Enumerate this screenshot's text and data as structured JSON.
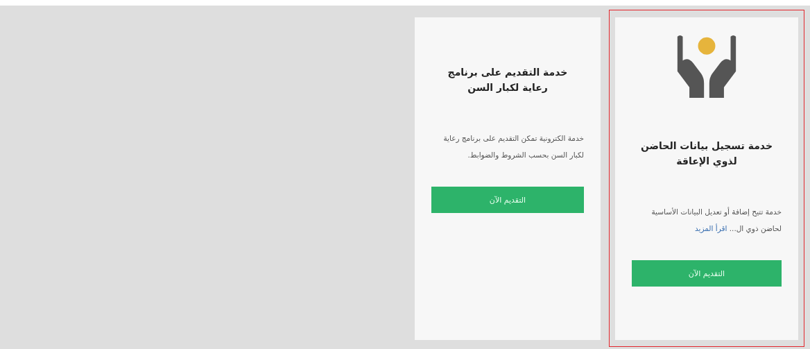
{
  "cards": [
    {
      "title": "خدمة تسجيل بيانات الحاضن لذوي الإعاقة",
      "description": "خدمة تتيح إضافة أو تعديل البيانات الأساسية لحاضن ذوي ال...",
      "link": "اقرأ المزيد",
      "button": "التقديم الآن",
      "has_icon": true,
      "highlighted": true
    },
    {
      "title": "خدمة التقديم على برنامج رعاية لكبار السن",
      "description": "خدمة الكترونية تمكن التقديم على برنامج رعاية لكبار السن بحسب الشروط والضوابط.",
      "button": "التقديم الآن",
      "has_icon": false,
      "highlighted": false
    }
  ]
}
